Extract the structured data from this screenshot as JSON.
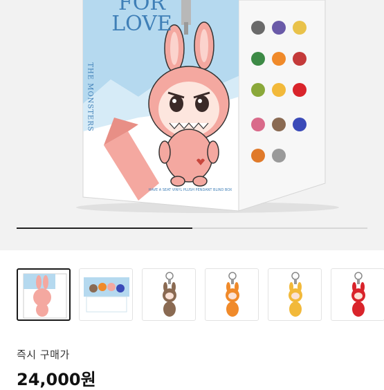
{
  "hero": {
    "box_title_line1": "FOR",
    "box_title_line2": "LOVE",
    "box_brand": "THE MONSTERS",
    "box_caption": "HAVE A SEAT VINYL PLUSH PENDANT BLIND BOX",
    "progress": 0.5
  },
  "thumbnails": [
    {
      "id": "thumb-box-front",
      "selected": true,
      "color": "#f4a8a0",
      "kind": "box"
    },
    {
      "id": "thumb-display-set",
      "selected": false,
      "color": "#e9d3b0",
      "kind": "set"
    },
    {
      "id": "thumb-keychain-brown",
      "selected": false,
      "color": "#8a6a52",
      "kind": "keychain"
    },
    {
      "id": "thumb-keychain-orange",
      "selected": false,
      "color": "#f08a2a",
      "kind": "keychain"
    },
    {
      "id": "thumb-keychain-yellow",
      "selected": false,
      "color": "#f2b93a",
      "kind": "keychain"
    },
    {
      "id": "thumb-keychain-red",
      "selected": false,
      "color": "#d9242b",
      "kind": "keychain"
    }
  ],
  "price": {
    "label": "즉시 구매가",
    "value": "24,000원"
  },
  "colors": {
    "sky": "#b5d9ef",
    "pink": "#f4a8a0",
    "accent_dark": "#1a1a1a"
  }
}
